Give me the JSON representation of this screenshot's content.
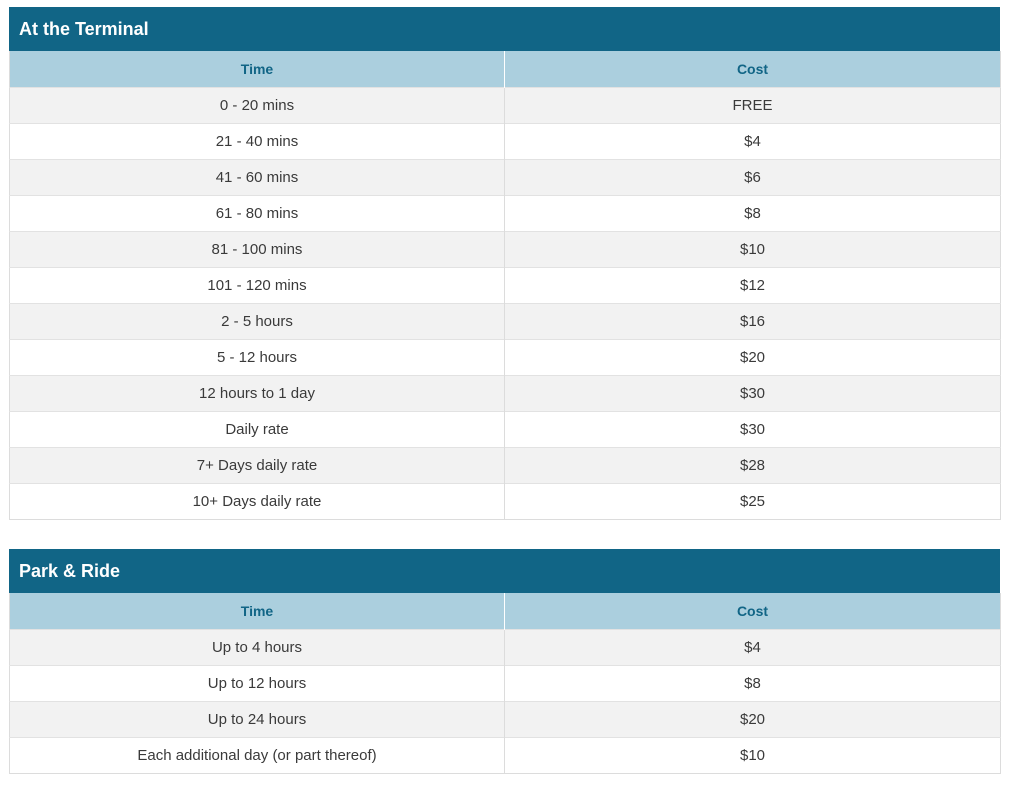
{
  "terminal": {
    "title": "At the Terminal",
    "headers": {
      "time": "Time",
      "cost": "Cost"
    },
    "rows": [
      {
        "time": "0 - 20 mins",
        "cost": "FREE"
      },
      {
        "time": "21 - 40 mins",
        "cost": "$4"
      },
      {
        "time": "41 - 60 mins",
        "cost": "$6"
      },
      {
        "time": "61 - 80 mins",
        "cost": "$8"
      },
      {
        "time": "81 - 100 mins",
        "cost": "$10"
      },
      {
        "time": "101 - 120 mins",
        "cost": "$12"
      },
      {
        "time": "2 - 5 hours",
        "cost": "$16"
      },
      {
        "time": "5 - 12 hours",
        "cost": "$20"
      },
      {
        "time": "12 hours to 1 day",
        "cost": "$30"
      },
      {
        "time": "Daily rate",
        "cost": "$30"
      },
      {
        "time": "7+ Days daily rate",
        "cost": "$28"
      },
      {
        "time": "10+ Days daily rate",
        "cost": "$25"
      }
    ]
  },
  "park_ride": {
    "title": "Park & Ride",
    "headers": {
      "time": "Time",
      "cost": "Cost"
    },
    "rows": [
      {
        "time": "Up to 4 hours",
        "cost": "$4"
      },
      {
        "time": "Up to 12 hours",
        "cost": "$8"
      },
      {
        "time": "Up to 24 hours",
        "cost": "$20"
      },
      {
        "time": "Each additional day (or part thereof)",
        "cost": "$10"
      }
    ]
  },
  "colors": {
    "header_bg": "#116586",
    "column_header_bg": "#abcfde",
    "column_header_text": "#116586",
    "row_alt_bg": "#f2f2f2"
  }
}
